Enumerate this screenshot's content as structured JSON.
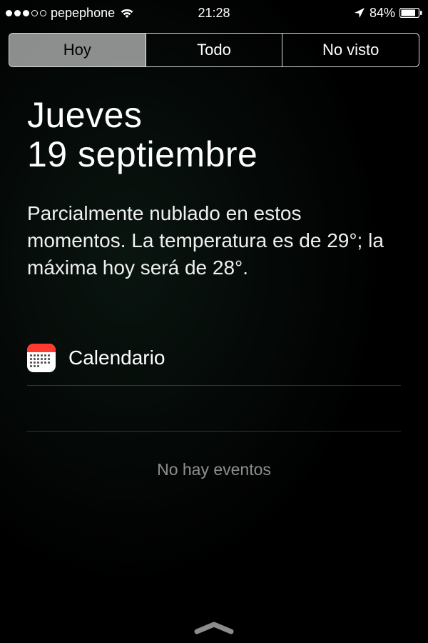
{
  "statusBar": {
    "carrier": "pepephone",
    "time": "21:28",
    "batteryPct": "84%"
  },
  "tabs": {
    "today": "Hoy",
    "all": "Todo",
    "unseen": "No visto"
  },
  "today": {
    "weekday": "Jueves",
    "date": "19 septiembre",
    "weather": "Parcialmente nublado en estos momentos. La temperatura es de 29°; la máxima hoy será de 28°."
  },
  "calendar": {
    "title": "Calendario",
    "empty": "No hay eventos"
  }
}
